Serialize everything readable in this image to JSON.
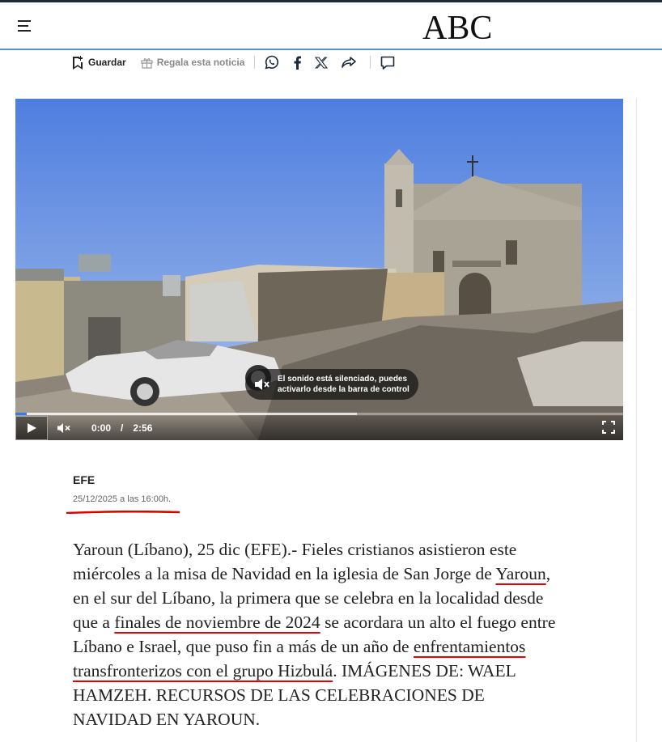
{
  "header": {
    "logo": "ABC",
    "menu_icon": "hamburger-menu-icon"
  },
  "actions": {
    "save_label": "Guardar",
    "gift_label": "Regala esta noticia",
    "share_icons": [
      "whatsapp-icon",
      "facebook-icon",
      "x-icon",
      "share-icon",
      "comment-icon"
    ]
  },
  "video": {
    "mute_message": "El sonido está silenciado, puedes activarlo desde la barra de control",
    "current_time": "0:00",
    "separator": "/",
    "duration": "2:56",
    "progress_fraction": 0.0,
    "buffered_fraction": 0.56
  },
  "article": {
    "author": "EFE",
    "date": "25/12/2025",
    "date_suffix": " a las 16:00h.",
    "body_1": "Yaroun (Líbano), 25 dic (EFE).- Fieles cristianos asistieron este miércoles a la misa de Navidad en la iglesia de San Jorge de ",
    "body_link_1": "Yaroun",
    "body_2": ", en el sur del Líbano, la primera que se celebra en la localidad desde que a ",
    "body_link_2": "finales de noviembre de 2024",
    "body_3": " se acordara un alto el fuego entre Líbano e Israel, que puso fin a más de un año de ",
    "body_link_3": "enfrentamientos transfronterizos con el grupo Hizbulá",
    "body_4": ". IMÁGENES DE: WAEL HAMZEH. RECURSOS DE LAS CELEBRACIONES DE NAVIDAD EN YAROUN."
  },
  "colors": {
    "accent_blue": "#2d7df6",
    "annotation_red": "#e00000",
    "header_border": "#5b8fd6"
  }
}
